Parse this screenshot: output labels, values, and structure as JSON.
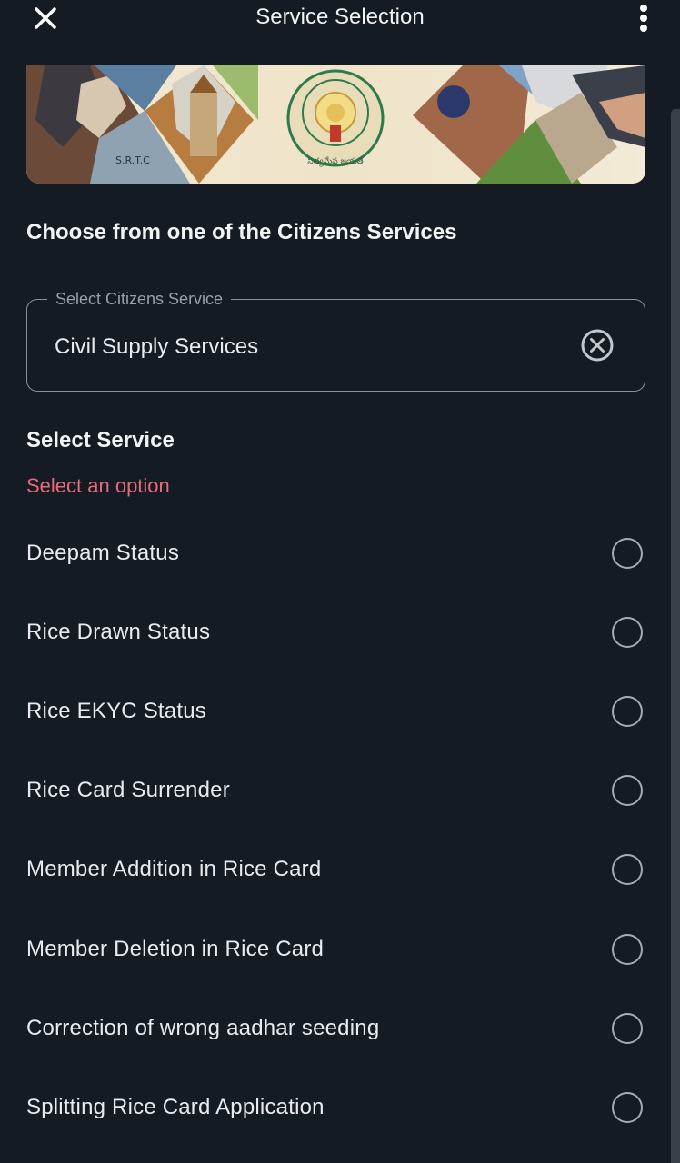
{
  "app_bar": {
    "title": "Service Selection",
    "close_icon": "close-icon",
    "menu_icon": "more-vert-icon"
  },
  "banner": {
    "emblem_text": "సత్యమేవ జయతే"
  },
  "heading": "Choose from one of the Citizens Services",
  "citizens_service": {
    "legend": "Select Citizens Service",
    "value": "Civil Supply Services",
    "clear_icon": "clear-circle-icon"
  },
  "select_service": {
    "title": "Select Service",
    "error": "Select an option",
    "options": [
      {
        "label": "Deepam Status",
        "selected": false
      },
      {
        "label": "Rice Drawn Status",
        "selected": false
      },
      {
        "label": "Rice EKYC Status",
        "selected": false
      },
      {
        "label": "Rice Card Surrender",
        "selected": false
      },
      {
        "label": "Member Addition in Rice Card",
        "selected": false
      },
      {
        "label": "Member Deletion in Rice Card",
        "selected": false
      },
      {
        "label": "Correction of wrong aadhar seeding",
        "selected": false
      },
      {
        "label": "Splitting Rice Card Application",
        "selected": false
      }
    ]
  },
  "colors": {
    "background": "#151b23",
    "error": "#e8697b",
    "border": "#8a9099",
    "radio": "#a6abb1"
  }
}
